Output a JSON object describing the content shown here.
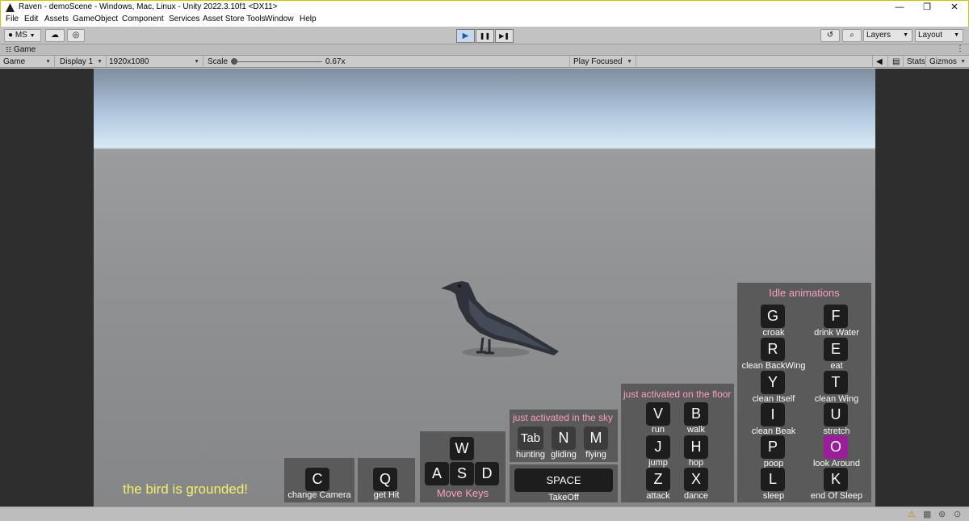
{
  "window": {
    "title": "Raven - demoScene - Windows, Mac, Linux - Unity 2022.3.10f1 <DX11>",
    "minimize": "—",
    "maximize": "❐",
    "close": "✕"
  },
  "menu": [
    "File",
    "Edit",
    "Assets",
    "GameObject",
    "Component",
    "Services",
    "Asset Store Tools",
    "Window",
    "Help"
  ],
  "toolbar": {
    "account": "MS",
    "layers": "Layers",
    "layout": "Layout",
    "play_icon": "▶",
    "pause_icon": "❚❚",
    "step_icon": "▶❚"
  },
  "tab": {
    "label": "Game"
  },
  "game_toolbar": {
    "view": "Game",
    "display": "Display 1",
    "resolution": "1920x1080",
    "scale_label": "Scale",
    "scale_value": "0.67x",
    "play_mode": "Play Focused",
    "stats": "Stats",
    "gizmos": "Gizmos"
  },
  "hud": {
    "status": "the bird is grounded!",
    "camera": {
      "key": "C",
      "label": "change Camera"
    },
    "hit": {
      "key": "Q",
      "label": "get Hit"
    },
    "move": {
      "w": "W",
      "a": "A",
      "s": "S",
      "d": "D",
      "label": "Move Keys"
    },
    "sky": {
      "title": "just activated in the sky",
      "k1": "Tab",
      "l1": "hunting",
      "k2": "N",
      "l2": "gliding",
      "k3": "M",
      "l3": "flying"
    },
    "takeoff": {
      "key": "SPACE",
      "label": "TakeOff"
    },
    "floor": {
      "title": "just activated on the floor",
      "keys": [
        {
          "key": "V",
          "label": "run"
        },
        {
          "key": "B",
          "label": "walk"
        },
        {
          "key": "J",
          "label": "jump"
        },
        {
          "key": "H",
          "label": "hop"
        },
        {
          "key": "Z",
          "label": "attack"
        },
        {
          "key": "X",
          "label": "dance"
        }
      ]
    },
    "idle": {
      "title": "Idle animations",
      "keys": [
        {
          "key": "G",
          "label": "croak"
        },
        {
          "key": "F",
          "label": "drink Water"
        },
        {
          "key": "R",
          "label": "clean BackWing"
        },
        {
          "key": "E",
          "label": "eat"
        },
        {
          "key": "Y",
          "label": "clean Itself"
        },
        {
          "key": "T",
          "label": "clean Wing"
        },
        {
          "key": "I",
          "label": "clean Beak"
        },
        {
          "key": "U",
          "label": "stretch"
        },
        {
          "key": "P",
          "label": "poop"
        },
        {
          "key": "O",
          "label": "look Around"
        },
        {
          "key": "L",
          "label": "sleep"
        },
        {
          "key": "K",
          "label": "end Of Sleep"
        }
      ],
      "highlight_color": "#9b1a9b"
    }
  }
}
